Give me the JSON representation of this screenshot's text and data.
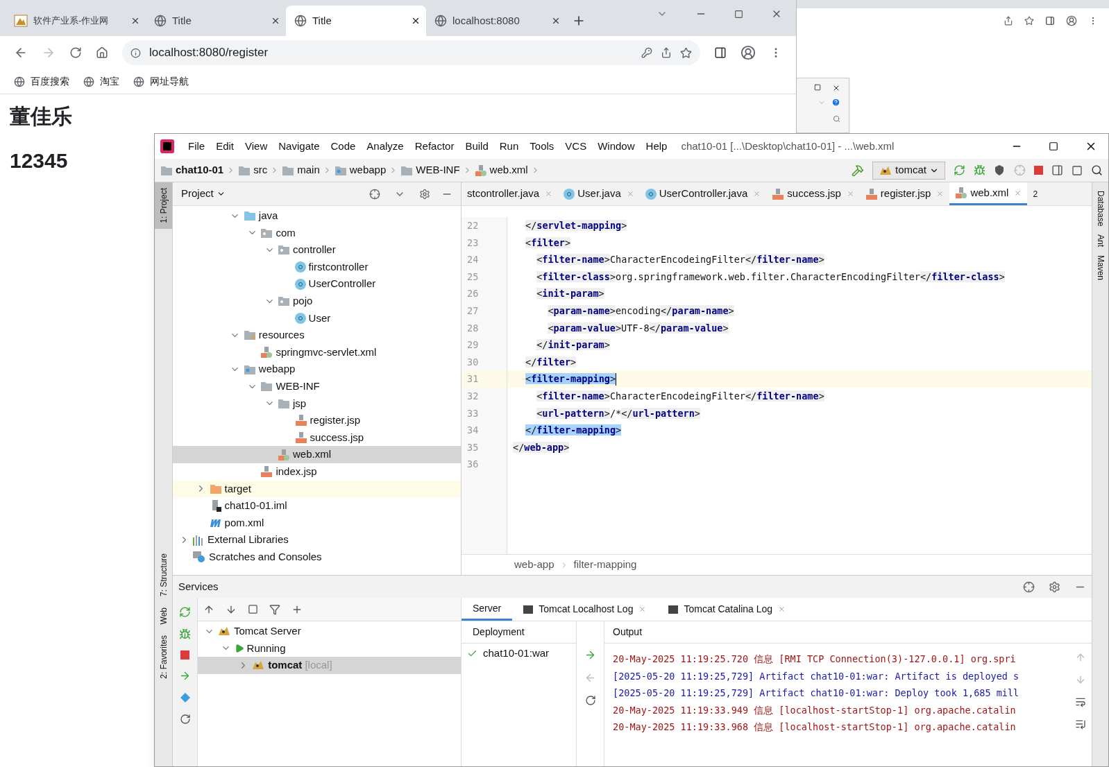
{
  "browser": {
    "tabs": [
      {
        "label": "软件产业系-作业网",
        "kind": "logo",
        "selected": false
      },
      {
        "label": "Title",
        "kind": "globe",
        "selected": false
      },
      {
        "label": "Title",
        "kind": "globe",
        "selected": true
      },
      {
        "label": "localhost:8080",
        "kind": "globe",
        "selected": false
      }
    ],
    "address": "localhost:8080/register",
    "bookmarks": [
      "百度搜索",
      "淘宝",
      "网址导航"
    ],
    "page": {
      "heading": "董佳乐",
      "text": "12345"
    }
  },
  "ide": {
    "menu": [
      "File",
      "Edit",
      "View",
      "Navigate",
      "Code",
      "Analyze",
      "Refactor",
      "Build",
      "Run",
      "Tools",
      "VCS",
      "Window",
      "Help"
    ],
    "title": "chat10-01 [...\\Desktop\\chat10-01] - ...\\web.xml",
    "breadcrumb": [
      {
        "label": "chat10-01",
        "kind": "project"
      },
      {
        "label": "src",
        "kind": "folder"
      },
      {
        "label": "main",
        "kind": "folder"
      },
      {
        "label": "webapp",
        "kind": "web"
      },
      {
        "label": "WEB-INF",
        "kind": "folder"
      },
      {
        "label": "web.xml",
        "kind": "xml"
      }
    ],
    "run_config": "tomcat",
    "left_tools": [
      {
        "label": "1: Project",
        "selected": true
      },
      {
        "label": "7: Structure",
        "selected": false
      },
      {
        "label": "Web",
        "selected": false
      },
      {
        "label": "2: Favorites",
        "selected": false
      }
    ],
    "right_tools": [
      "Database",
      "Ant",
      "Maven"
    ],
    "project": {
      "title": "Project",
      "tree": [
        {
          "children": [
            {
              "children": [
                {
                  "children": [
                    {
                      "label": "java",
                      "kind": "src",
                      "expanded": true,
                      "children": [
                        {
                          "label": "com",
                          "kind": "package",
                          "expanded": true,
                          "children": [
                            {
                              "label": "controller",
                              "kind": "package",
                              "expanded": true,
                              "children": [
                                {
                                  "label": "firstcontroller",
                                  "kind": "class"
                                },
                                {
                                  "label": "UserController",
                                  "kind": "class"
                                }
                              ]
                            },
                            {
                              "label": "pojo",
                              "kind": "package",
                              "expanded": true,
                              "children": [
                                {
                                  "label": "User",
                                  "kind": "class"
                                }
                              ]
                            }
                          ]
                        }
                      ]
                    },
                    {
                      "label": "resources",
                      "kind": "resources",
                      "expanded": true,
                      "children": [
                        {
                          "label": "springmvc-servlet.xml",
                          "kind": "xml"
                        }
                      ]
                    },
                    {
                      "label": "webapp",
                      "kind": "web",
                      "expanded": true,
                      "children": [
                        {
                          "label": "WEB-INF",
                          "kind": "folder",
                          "expanded": true,
                          "children": [
                            {
                              "label": "jsp",
                              "kind": "folder",
                              "expanded": true,
                              "children": [
                                {
                                  "label": "register.jsp",
                                  "kind": "jsp"
                                },
                                {
                                  "label": "success.jsp",
                                  "kind": "jsp"
                                }
                              ]
                            },
                            {
                              "label": "web.xml",
                              "kind": "xml",
                              "selected": true
                            }
                          ]
                        },
                        {
                          "label": "index.jsp",
                          "kind": "jsp"
                        }
                      ]
                    }
                  ]
                }
              ]
            },
            {
              "label": "target",
              "kind": "excluded",
              "expanded": false
            },
            {
              "label": "chat10-01.iml",
              "kind": "iml"
            },
            {
              "label": "pom.xml",
              "kind": "maven"
            }
          ]
        },
        {
          "label": "External Libraries",
          "kind": "libraries",
          "expanded": false
        },
        {
          "label": "Scratches and Consoles",
          "kind": "scratches"
        }
      ]
    },
    "editor_tabs": [
      {
        "label": "stcontroller.java",
        "selected": false
      },
      {
        "label": "User.java",
        "kind": "class",
        "selected": false
      },
      {
        "label": "UserController.java",
        "kind": "class",
        "selected": false
      },
      {
        "label": "success.jsp",
        "kind": "jsp",
        "selected": false
      },
      {
        "label": "register.jsp",
        "kind": "jsp",
        "selected": false
      },
      {
        "label": "web.xml",
        "kind": "xml",
        "selected": true
      }
    ],
    "tab_overflow": "2",
    "code": [
      {
        "n": "22",
        "text": "</servlet-mapping>"
      },
      {
        "n": "23",
        "text": "<filter>"
      },
      {
        "n": "24",
        "text": "  <filter-name>CharacterEncodeingFilter</filter-name>"
      },
      {
        "n": "25",
        "text": "  <filter-class>org.springframework.web.filter.CharacterEncodingFilter</filter-class>"
      },
      {
        "n": "26",
        "text": "  <init-param>"
      },
      {
        "n": "27",
        "text": "    <param-name>encoding</param-name>"
      },
      {
        "n": "28",
        "text": "    <param-value>UTF-8</param-value>"
      },
      {
        "n": "29",
        "text": "  </init-param>"
      },
      {
        "n": "30",
        "text": "</filter>"
      },
      {
        "n": "31",
        "text": "<filter-mapping>",
        "current": true,
        "highlighted": true
      },
      {
        "n": "32",
        "text": "  <filter-name>CharacterEncodeingFilter</filter-name>"
      },
      {
        "n": "33",
        "text": "  <url-pattern>/*</url-pattern>"
      },
      {
        "n": "34",
        "text": "</filter-mapping>",
        "highlighted": true
      },
      {
        "n": "35",
        "text": "</web-app>",
        "outdent": true
      },
      {
        "n": "36"
      }
    ],
    "editor_breadcrumb": [
      "web-app",
      "filter-mapping"
    ],
    "services": {
      "title": "Services",
      "tree": [
        {
          "label": "Tomcat Server",
          "kind": "server",
          "expanded": true,
          "children": [
            {
              "label": "Running",
              "kind": "running",
              "expanded": true,
              "children": [
                {
                  "label": "tomcat",
                  "suffix": "[local]",
                  "kind": "tomcat",
                  "expanded": false,
                  "selected": true
                }
              ]
            }
          ]
        }
      ],
      "tabs": [
        {
          "label": "Server",
          "kind": "plain",
          "selected": true
        },
        {
          "label": "Tomcat Localhost Log",
          "kind": "log",
          "selected": false
        },
        {
          "label": "Tomcat Catalina Log",
          "kind": "log",
          "selected": false
        }
      ],
      "deployment": {
        "title": "Deployment",
        "items": [
          "chat10-01:war"
        ]
      },
      "output": {
        "title": "Output",
        "lines": [
          {
            "text": "20-May-2025 11:19:25.720 信息 [RMI TCP Connection(3)-127.0.0.1] org.spri",
            "kind": "info"
          },
          {
            "text": "[2025-05-20 11:19:25,729] Artifact chat10-01:war: Artifact is deployed s",
            "kind": "artifact"
          },
          {
            "text": "[2025-05-20 11:19:25,729] Artifact chat10-01:war: Deploy took 1,685 mill",
            "kind": "artifact"
          },
          {
            "text": "20-May-2025 11:19:33.949 信息 [localhost-startStop-1] org.apache.catalin",
            "kind": "info"
          },
          {
            "text": "20-May-2025 11:19:33.968 信息 [localhost-startStop-1] org.apache.catalin",
            "kind": "info"
          }
        ]
      }
    }
  }
}
